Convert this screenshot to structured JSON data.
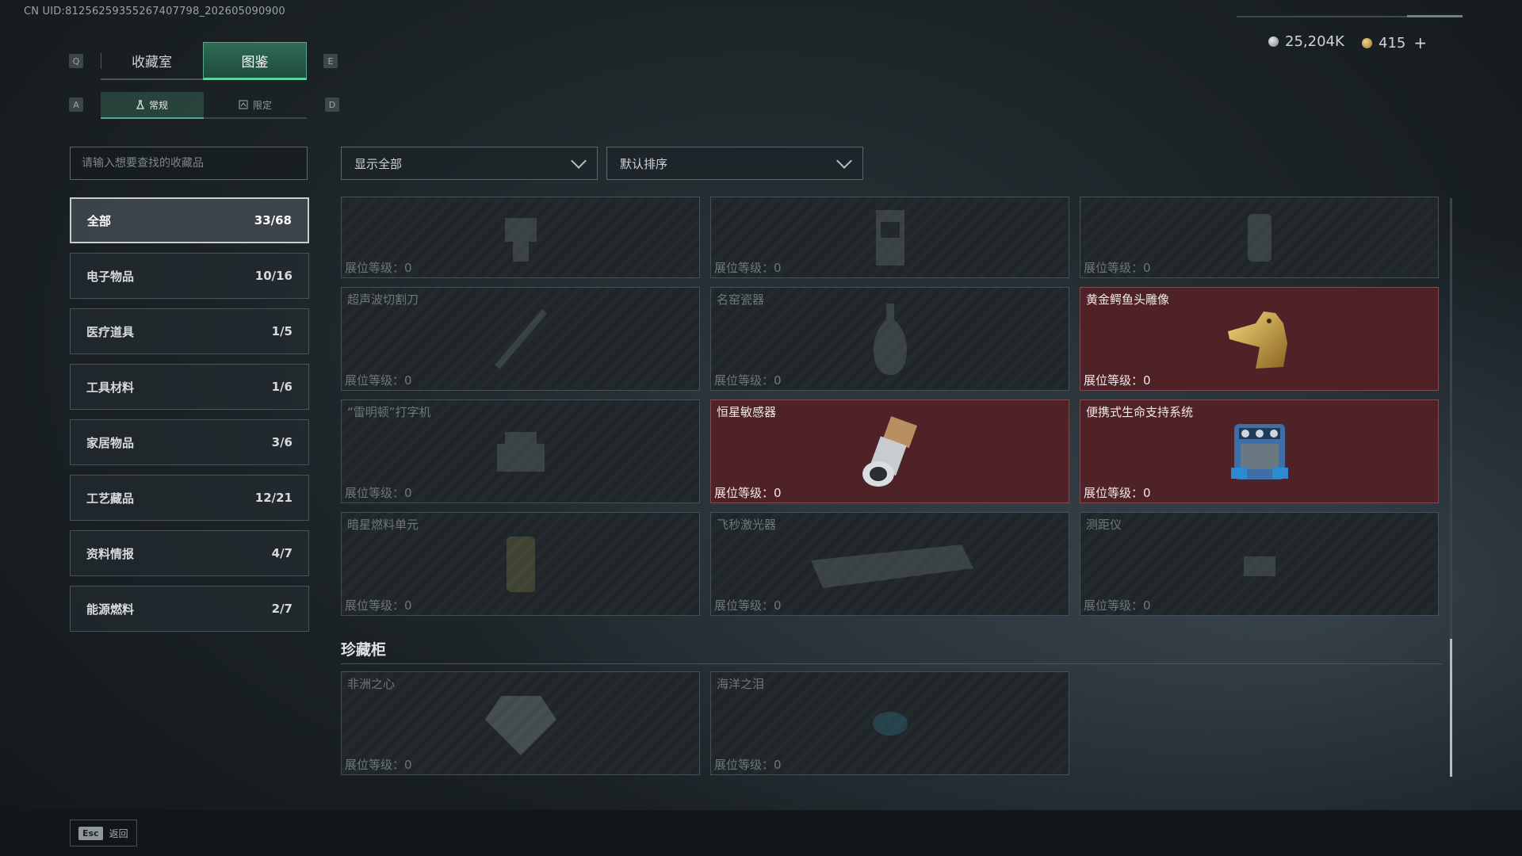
{
  "uid": "CN UID:81256259355267407798_202605090900",
  "currency": {
    "silver": "25,204K",
    "gold": "415",
    "add": "+"
  },
  "keys": {
    "prev_tab": "Q",
    "next_tab": "E",
    "prev_sub": "A",
    "next_sub": "D"
  },
  "tabs": [
    {
      "label": "收藏室"
    },
    {
      "label": "图鉴"
    }
  ],
  "subtabs": [
    {
      "label": "常规"
    },
    {
      "label": "限定"
    }
  ],
  "search": {
    "placeholder": "请输入想要查找的收藏品"
  },
  "categories": [
    {
      "label": "全部",
      "count": "33/68"
    },
    {
      "label": "电子物品",
      "count": "10/16"
    },
    {
      "label": "医疗道具",
      "count": "1/5"
    },
    {
      "label": "工具材料",
      "count": "1/6"
    },
    {
      "label": "家居物品",
      "count": "3/6"
    },
    {
      "label": "工艺藏品",
      "count": "12/21"
    },
    {
      "label": "资料情报",
      "count": "4/7"
    },
    {
      "label": "能源燃料",
      "count": "2/7"
    }
  ],
  "filter": {
    "label": "显示全部"
  },
  "sort": {
    "label": "默认排序"
  },
  "items": [
    {
      "name": "",
      "level": "展位等级：0",
      "owned": false,
      "icon": "robot-part-icon"
    },
    {
      "name": "",
      "level": "展位等级：0",
      "owned": false,
      "icon": "machine-icon"
    },
    {
      "name": "",
      "level": "展位等级：0",
      "owned": false,
      "icon": "lantern-icon"
    },
    {
      "name": "超声波切割刀",
      "level": "展位等级：0",
      "owned": false,
      "icon": "ultrasonic-cutter-icon"
    },
    {
      "name": "名窑瓷器",
      "level": "展位等级：0",
      "owned": false,
      "icon": "porcelain-vase-icon"
    },
    {
      "name": "黄金鳄鱼头雕像",
      "level": "展位等级：0",
      "owned": true,
      "icon": "golden-crocodile-statue-icon"
    },
    {
      "name": "“雷明顿”打字机",
      "level": "展位等级：0",
      "owned": false,
      "icon": "typewriter-icon"
    },
    {
      "name": "恒星敏感器",
      "level": "展位等级：0",
      "owned": true,
      "icon": "star-sensor-icon"
    },
    {
      "name": "便携式生命支持系统",
      "level": "展位等级：0",
      "owned": true,
      "icon": "life-support-system-icon"
    },
    {
      "name": "暗星燃料单元",
      "level": "展位等级：0",
      "owned": false,
      "icon": "fuel-cell-icon"
    },
    {
      "name": "飞秒激光器",
      "level": "展位等级：0",
      "owned": false,
      "icon": "laser-device-icon"
    },
    {
      "name": "测距仪",
      "level": "展位等级：0",
      "owned": false,
      "icon": "rangefinder-icon"
    }
  ],
  "section": {
    "title": "珍藏柜"
  },
  "treasures": [
    {
      "name": "非洲之心",
      "level": "展位等级：0",
      "owned": false,
      "icon": "diamond-icon"
    },
    {
      "name": "海洋之泪",
      "level": "展位等级：0",
      "owned": false,
      "icon": "gem-icon"
    }
  ],
  "footer": {
    "esc_key": "Esc",
    "back_label": "返回"
  }
}
